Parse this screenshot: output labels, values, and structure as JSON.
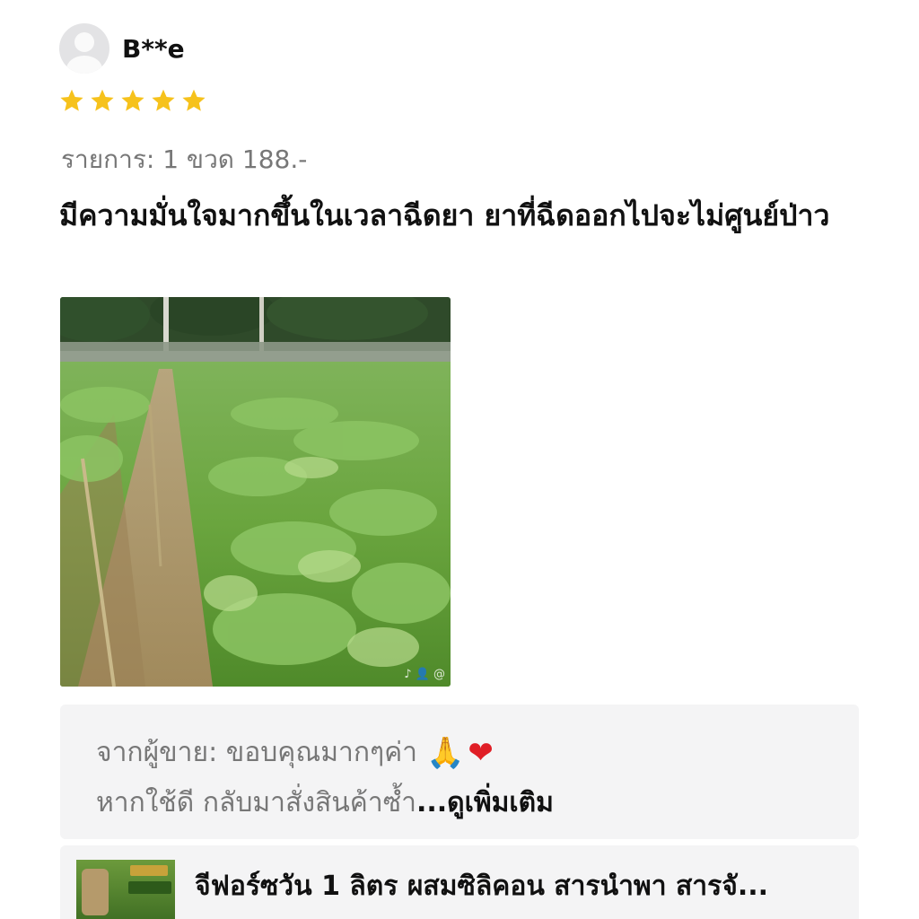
{
  "reviewer": {
    "username": "B**e",
    "avatar_icon": "default-user-avatar-icon"
  },
  "rating": {
    "stars": 5,
    "max": 5,
    "color": "#f6c21c"
  },
  "review": {
    "variation": "รายการ: 1 ขวด 188.-",
    "text": "มีความมั่นใจมากขึ้นในเวลาฉีดยา ยาที่ฉีดออกไปจะไม่ศูนย์ป่าว",
    "photo_watermark": "♪ 👤 @"
  },
  "seller_reply": {
    "line1": "จากผู้ขาย: ขอบคุณมากๆค่า",
    "emoji1": "🙏",
    "emoji2": "❤",
    "line2": "หากใช้ดี กลับมาสั่งสินค้าซ้ำ",
    "see_more": "...ดูเพิ่มเติม"
  },
  "product": {
    "name": "จีฟอร์ซวัน 1 ลิตร ผสมซิลิคอน สารนำพา สารจั..."
  }
}
